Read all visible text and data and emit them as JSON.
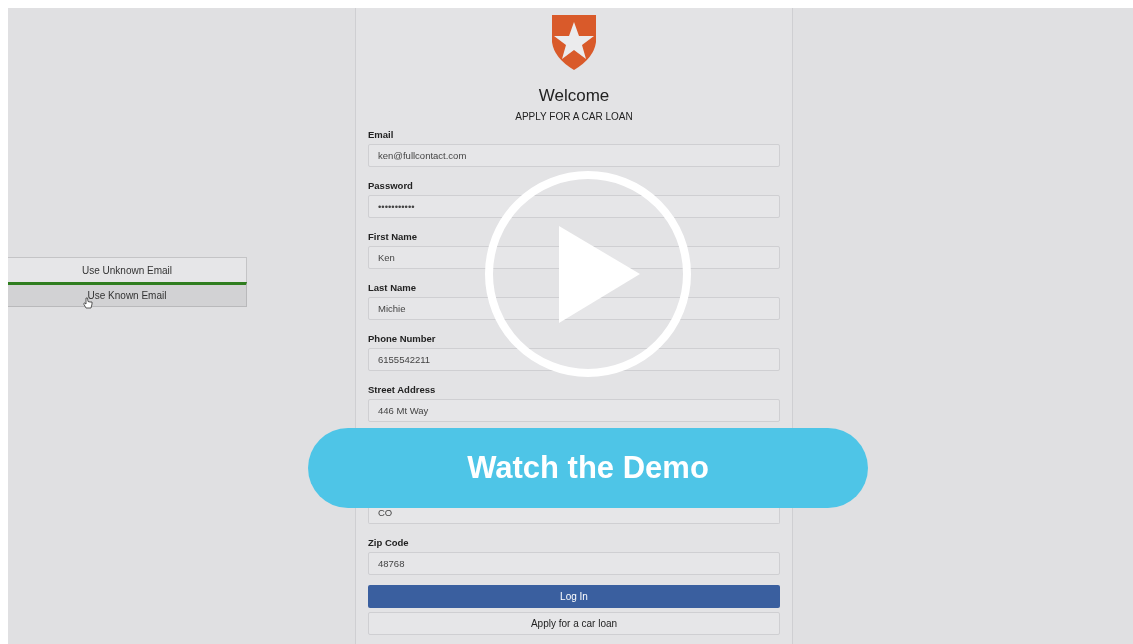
{
  "demo_buttons": [
    {
      "label": "Use Unknown Email",
      "selected": false
    },
    {
      "label": "Use Known Email",
      "selected": true
    }
  ],
  "form": {
    "title": "Welcome",
    "subtitle": "APPLY FOR A CAR LOAN",
    "fields": [
      {
        "label": "Email",
        "value": "ken@fullcontact.com"
      },
      {
        "label": "Password",
        "value": "•••••••••••"
      },
      {
        "label": "First Name",
        "value": "Ken"
      },
      {
        "label": "Last Name",
        "value": "Michie"
      },
      {
        "label": "Phone Number",
        "value": "6155542211"
      },
      {
        "label": "Street Address",
        "value": "446 Mt Way"
      },
      {
        "value": "CO"
      },
      {
        "label": "Zip Code",
        "value": "48768"
      }
    ],
    "primary_button": "Log In",
    "secondary_button": "Apply for a car loan"
  },
  "video_overlay": {
    "cta": "Watch the Demo"
  }
}
